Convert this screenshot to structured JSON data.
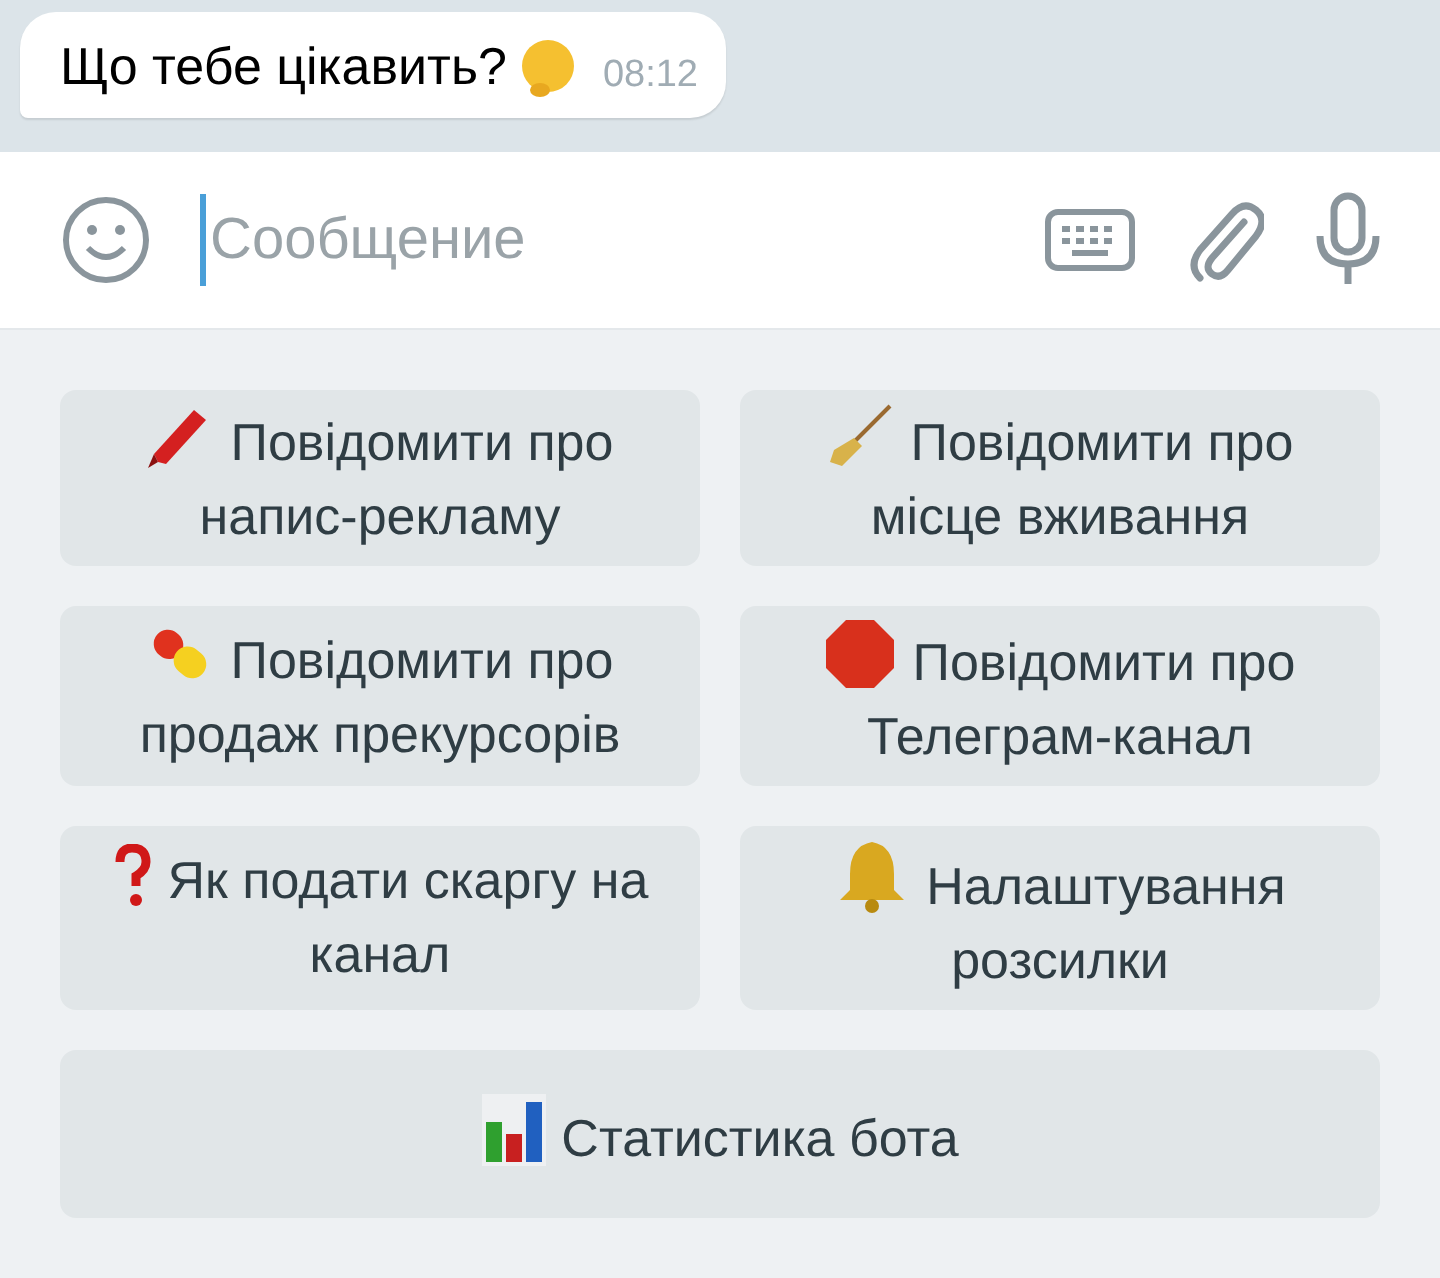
{
  "message": {
    "text": "Що тебе цікавить?",
    "time": "08:12"
  },
  "composer": {
    "placeholder": "Сообщение"
  },
  "keyboard": [
    {
      "label": "Повідомити про напис-рекламу",
      "wide": false
    },
    {
      "label": "Повідомити про місце вживання",
      "wide": false
    },
    {
      "label": "Повідомити про продаж прекурсорів",
      "wide": false
    },
    {
      "label": "Повідомити про Телеграм-канал",
      "wide": false
    },
    {
      "label": "Як подати скаргу на канал",
      "wide": false
    },
    {
      "label": "Налаштування розсилки",
      "wide": false
    },
    {
      "label": "Статистика бота",
      "wide": true
    }
  ]
}
